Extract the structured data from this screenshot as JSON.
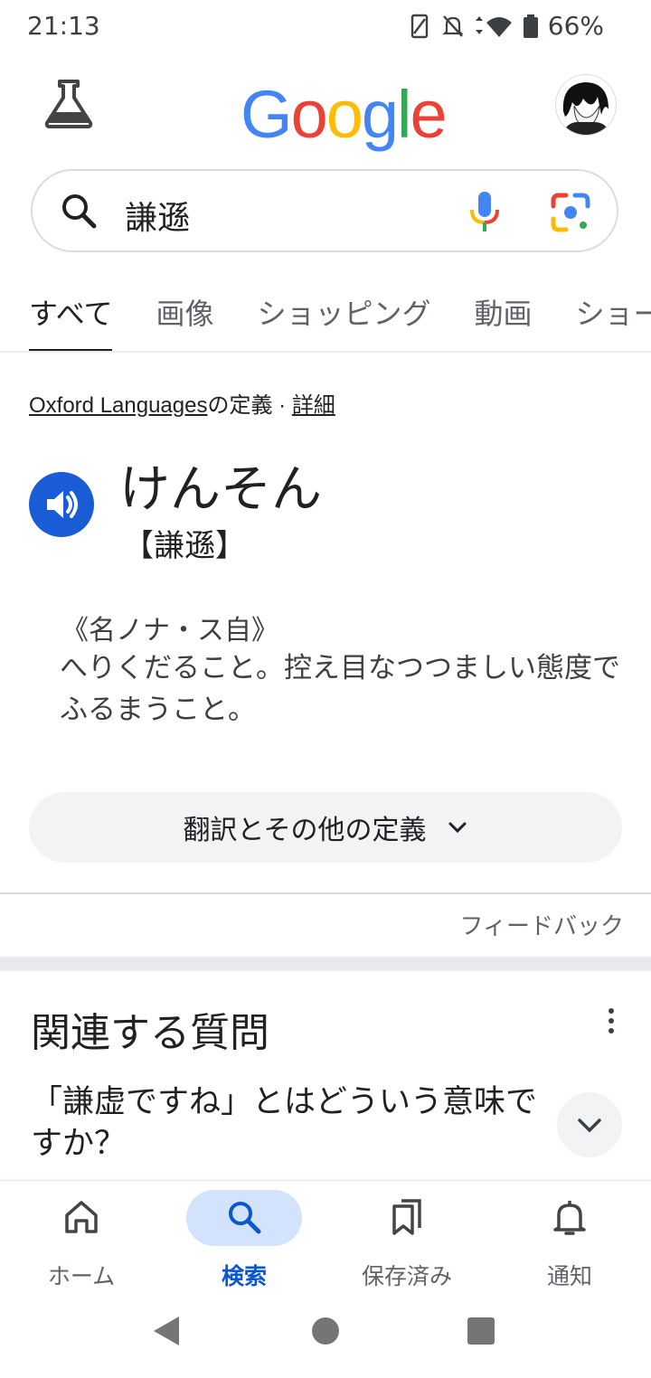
{
  "status_bar": {
    "time": "21:13",
    "battery": "66%"
  },
  "header": {
    "logo": [
      "G",
      "o",
      "o",
      "g",
      "l",
      "e"
    ],
    "logo_colors": [
      "#4285F4",
      "#EA4335",
      "#FBBC05",
      "#4285F4",
      "#34A853",
      "#EA4335"
    ]
  },
  "search": {
    "query": "謙遜"
  },
  "tabs": [
    "すべて",
    "画像",
    "ショッピング",
    "動画",
    "ショー"
  ],
  "definition": {
    "source_link": "Oxford Languages",
    "source_suffix": "の定義 · ",
    "details_link": "詳細",
    "headword": "けんそん",
    "kanji": "【謙遜】",
    "pos": "《名ノナ・ス自》",
    "gloss": "へりくだること。控え目なつつましい態度でふるまうこと。",
    "more_button": "翻訳とその他の定義",
    "feedback": "フィードバック"
  },
  "related": {
    "title": "関連する質問",
    "question": "「謙虚ですね」とはどういう意味ですか？"
  },
  "bottom_nav": [
    {
      "label": "ホーム",
      "icon": "home-icon"
    },
    {
      "label": "検索",
      "icon": "search-icon"
    },
    {
      "label": "保存済み",
      "icon": "bookmark-icon"
    },
    {
      "label": "通知",
      "icon": "bell-icon"
    }
  ],
  "colors": {
    "accent": "#0b57d0",
    "speaker": "#1a5bd6",
    "pill": "#d3e3fd"
  }
}
